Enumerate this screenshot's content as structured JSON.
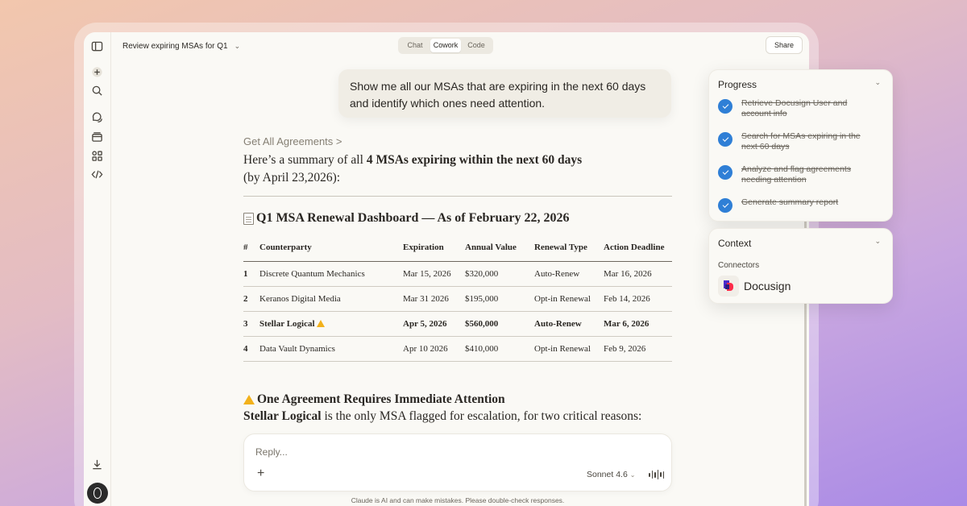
{
  "header": {
    "title": "Review expiring MSAs for Q1",
    "modes": [
      "Chat",
      "Cowork",
      "Code"
    ],
    "active_mode": "Cowork",
    "share_label": "Share"
  },
  "user_message": "Show me all our MSAs that are expiring in the next 60 days and identify which ones need attention.",
  "response": {
    "breadcrumb": "Get All Agreements >",
    "summary_prefix": "Here’s a summary of all ",
    "summary_bold": "4 MSAs expiring within the next 60 days",
    "summary_suffix": "(by April 23,2026):",
    "dashboard_title": "Q1 MSA Renewal Dashboard — As of February 22, 2026",
    "table": {
      "headers": [
        "#",
        "Counterparty",
        "Expiration",
        "Annual Value",
        "Renewal Type",
        "Action Deadline"
      ],
      "rows": [
        [
          "1",
          "Discrete Quantum Mechanics",
          "Mar 15, 2026",
          "$320,000",
          "Auto-Renew",
          "Mar 16, 2026"
        ],
        [
          "2",
          "Keranos Digital Media",
          "Mar 31 2026",
          "$195,000",
          "Opt-in Renewal",
          "Feb 14, 2026"
        ],
        [
          "3",
          "Stellar Logical",
          "Apr 5, 2026",
          "$560,000",
          "Auto-Renew",
          "Mar 6, 2026"
        ],
        [
          "4",
          "Data Vault Dynamics",
          "Apr 10 2026",
          "$410,000",
          "Opt-in Renewal",
          "Feb 9, 2026"
        ]
      ],
      "flagged_row": 2
    },
    "attention_title": "One Agreement Requires Immediate Attention",
    "attention_bold": "Stellar Logical",
    "attention_text": " is the only MSA flagged for escalation, for two critical reasons:"
  },
  "reply": {
    "placeholder": "Reply...",
    "model": "Sonnet 4.6",
    "disclaimer": "Claude is AI and can make mistakes. Please double-check responses."
  },
  "progress": {
    "title": "Progress",
    "steps": [
      "Retrieve Docusign User and account info",
      "Search for MSAs expiring in the next 60 days",
      "Analyze and flag agreements needing attention",
      "Generate summary report"
    ]
  },
  "context": {
    "title": "Context",
    "connectors_label": "Connectors",
    "connector_name": "Docusign"
  },
  "colors": {
    "accent_check": "#2f7fd6",
    "warning": "#f2b11b"
  }
}
